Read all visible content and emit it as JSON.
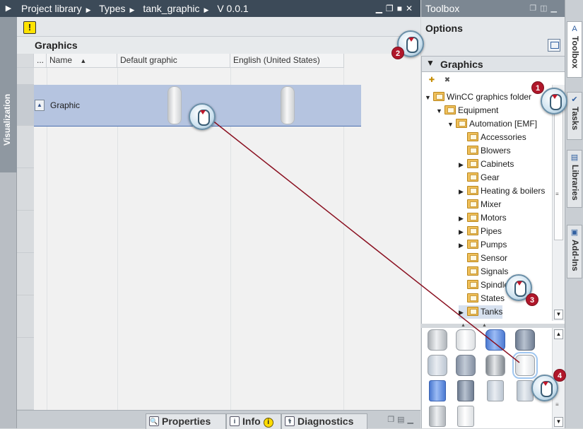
{
  "visualization_tab": {
    "label": "Visualization"
  },
  "library": {
    "breadcrumb": [
      "Project library",
      "Types",
      "tank_graphic",
      "V 0.0.1"
    ],
    "section_title": "Graphics",
    "columns": [
      "...",
      "Name",
      "Default graphic",
      "English (United States)"
    ],
    "sort_indicator": "▲",
    "rows": [
      {
        "name": "Graphic"
      }
    ]
  },
  "bottom_tabs": {
    "properties": "Properties",
    "info": "Info",
    "info_badge": "i",
    "diagnostics": "Diagnostics"
  },
  "toolbox": {
    "header": "Toolbox",
    "options_title": "Options",
    "graphics_pane_title": "Graphics",
    "tree": [
      {
        "label": "WinCC graphics folder",
        "expander": "▼"
      },
      {
        "label": "Equipment",
        "expander": "▼"
      },
      {
        "label": "Automation [EMF]",
        "expander": "▼"
      },
      {
        "label": "Accessories",
        "expander": ""
      },
      {
        "label": "Blowers",
        "expander": ""
      },
      {
        "label": "Cabinets",
        "expander": "▶"
      },
      {
        "label": "Gear",
        "expander": ""
      },
      {
        "label": "Heating & boilers",
        "expander": "▶"
      },
      {
        "label": "Mixer",
        "expander": ""
      },
      {
        "label": "Motors",
        "expander": "▶"
      },
      {
        "label": "Pipes",
        "expander": "▶"
      },
      {
        "label": "Pumps",
        "expander": "▶"
      },
      {
        "label": "Sensor",
        "expander": ""
      },
      {
        "label": "Signals",
        "expander": ""
      },
      {
        "label": "Spindles",
        "expander": ""
      },
      {
        "label": "States",
        "expander": ""
      },
      {
        "label": "Tanks",
        "expander": "▶"
      }
    ]
  },
  "right_tabs": [
    "Toolbox",
    "Tasks",
    "Libraries",
    "Add-Ins"
  ],
  "callouts": [
    "1",
    "2",
    "3",
    "4"
  ],
  "colors": {
    "accent_red": "#b0172a",
    "selection_blue": "#b5c4e0",
    "header_dark": "#3c4a58"
  }
}
